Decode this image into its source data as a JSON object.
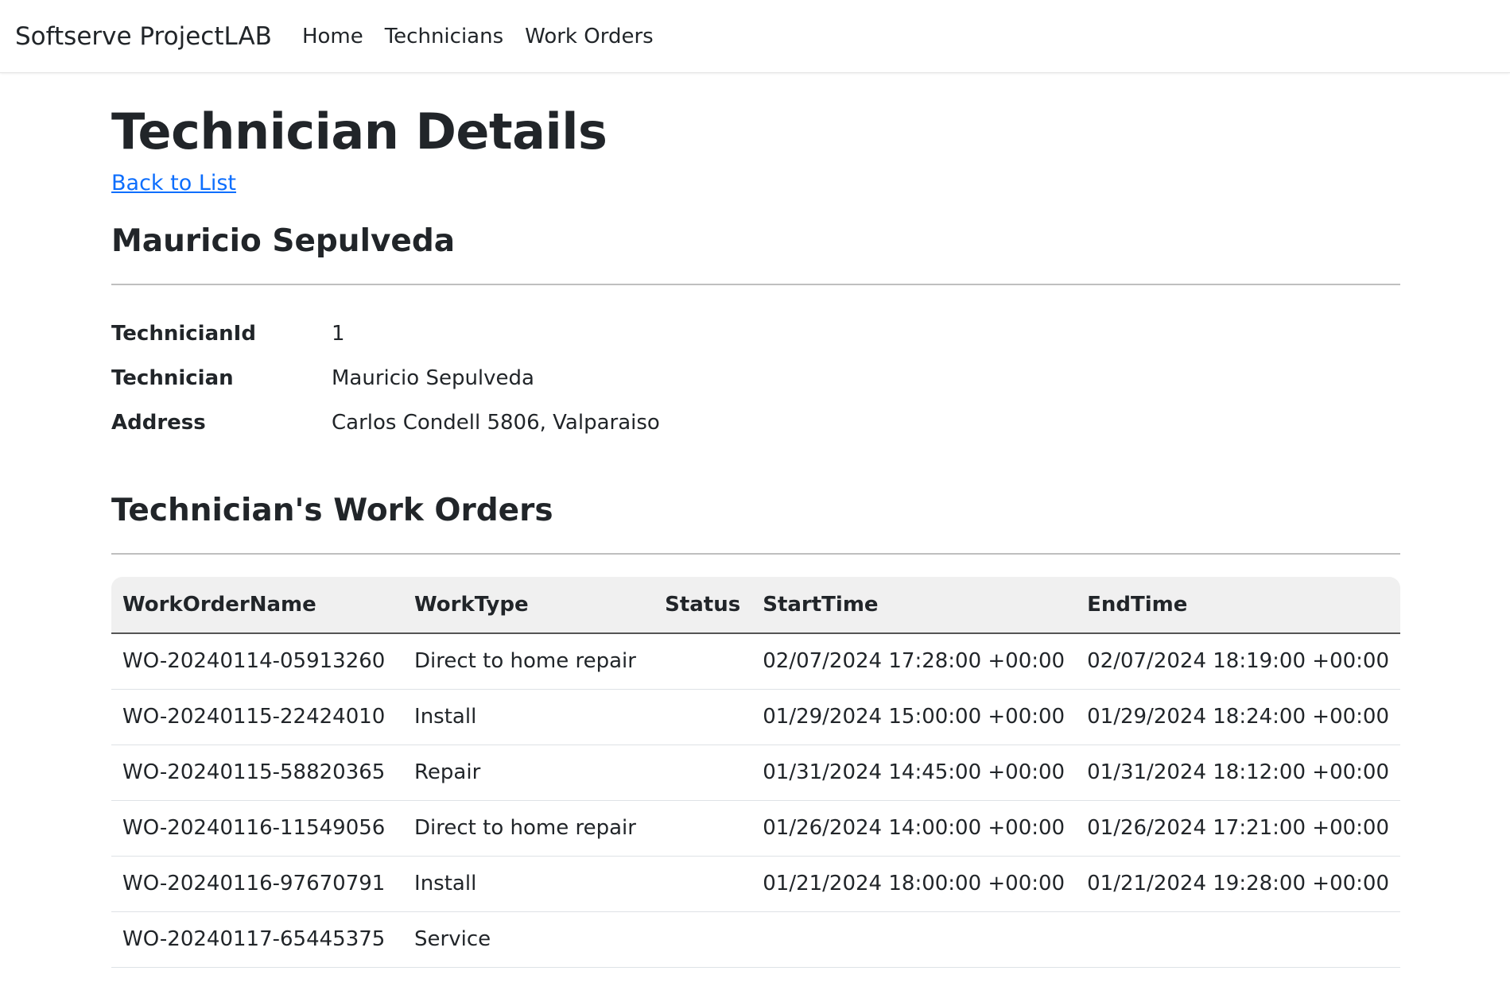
{
  "navbar": {
    "brand": "Softserve ProjectLAB",
    "links": [
      "Home",
      "Technicians",
      "Work Orders"
    ]
  },
  "page": {
    "title": "Technician Details",
    "back_link": "Back to List",
    "technician_name": "Mauricio Sepulveda"
  },
  "details": [
    {
      "label": "TechnicianId",
      "value": "1"
    },
    {
      "label": "Technician",
      "value": "Mauricio Sepulveda"
    },
    {
      "label": "Address",
      "value": "Carlos Condell 5806, Valparaiso"
    }
  ],
  "orders": {
    "title": "Technician's Work Orders",
    "columns": [
      "WorkOrderName",
      "WorkType",
      "Status",
      "StartTime",
      "EndTime"
    ],
    "rows": [
      [
        "WO-20240114-05913260",
        "Direct to home repair",
        "",
        "02/07/2024 17:28:00 +00:00",
        "02/07/2024 18:19:00 +00:00"
      ],
      [
        "WO-20240115-22424010",
        "Install",
        "",
        "01/29/2024 15:00:00 +00:00",
        "01/29/2024 18:24:00 +00:00"
      ],
      [
        "WO-20240115-58820365",
        "Repair",
        "",
        "01/31/2024 14:45:00 +00:00",
        "01/31/2024 18:12:00 +00:00"
      ],
      [
        "WO-20240116-11549056",
        "Direct to home repair",
        "",
        "01/26/2024 14:00:00 +00:00",
        "01/26/2024 17:21:00 +00:00"
      ],
      [
        "WO-20240116-97670791",
        "Install",
        "",
        "01/21/2024 18:00:00 +00:00",
        "01/21/2024 19:28:00 +00:00"
      ],
      [
        "WO-20240117-65445375",
        "Service",
        "",
        "",
        ""
      ]
    ]
  },
  "colors": {
    "link": "#0d6efd",
    "text": "#212529",
    "header_bg": "#f0f0f0"
  }
}
